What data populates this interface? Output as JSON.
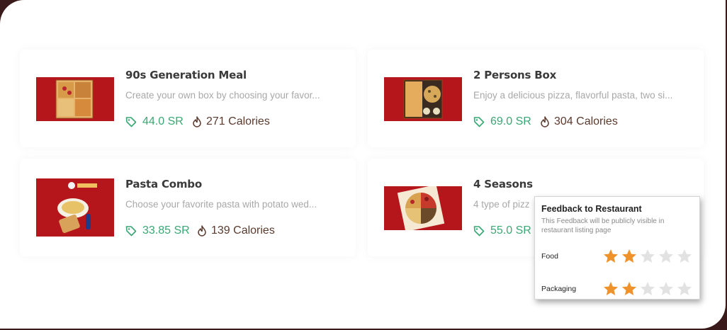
{
  "items": [
    {
      "title": "90s Generation Meal",
      "description": "Create your own box by choosing your favor...",
      "price": "44.0 SR",
      "calories": "271 Calories"
    },
    {
      "title": "2 Persons Box",
      "description": "Enjoy a delicious pizza, flavorful pasta, two si...",
      "price": "69.0 SR",
      "calories": "304 Calories"
    },
    {
      "title": "Pasta Combo",
      "description": "Choose your favorite pasta with potato wed...",
      "price": "33.85 SR",
      "calories": "139 Calories"
    },
    {
      "title": "4 Seasons",
      "description": "4 type of pizz",
      "price": "55.0 SR",
      "calories": ""
    }
  ],
  "feedback": {
    "title": "Feedback to Restaurant",
    "subtitle": "This Feedback will be publicly visible in restaurant listing page",
    "ratings": [
      {
        "label": "Food",
        "value": 2,
        "max": 5
      },
      {
        "label": "Packaging",
        "value": 2,
        "max": 5
      }
    ]
  },
  "colors": {
    "price": "#3aa874",
    "calories": "#5b3a2e",
    "thumbnail_bg": "#b5161b",
    "star_filled": "#f0922a",
    "star_empty": "#e2e2e2"
  },
  "icons": {
    "price": "price-tag-icon",
    "calories": "flame-icon",
    "rating": "star-icon"
  }
}
